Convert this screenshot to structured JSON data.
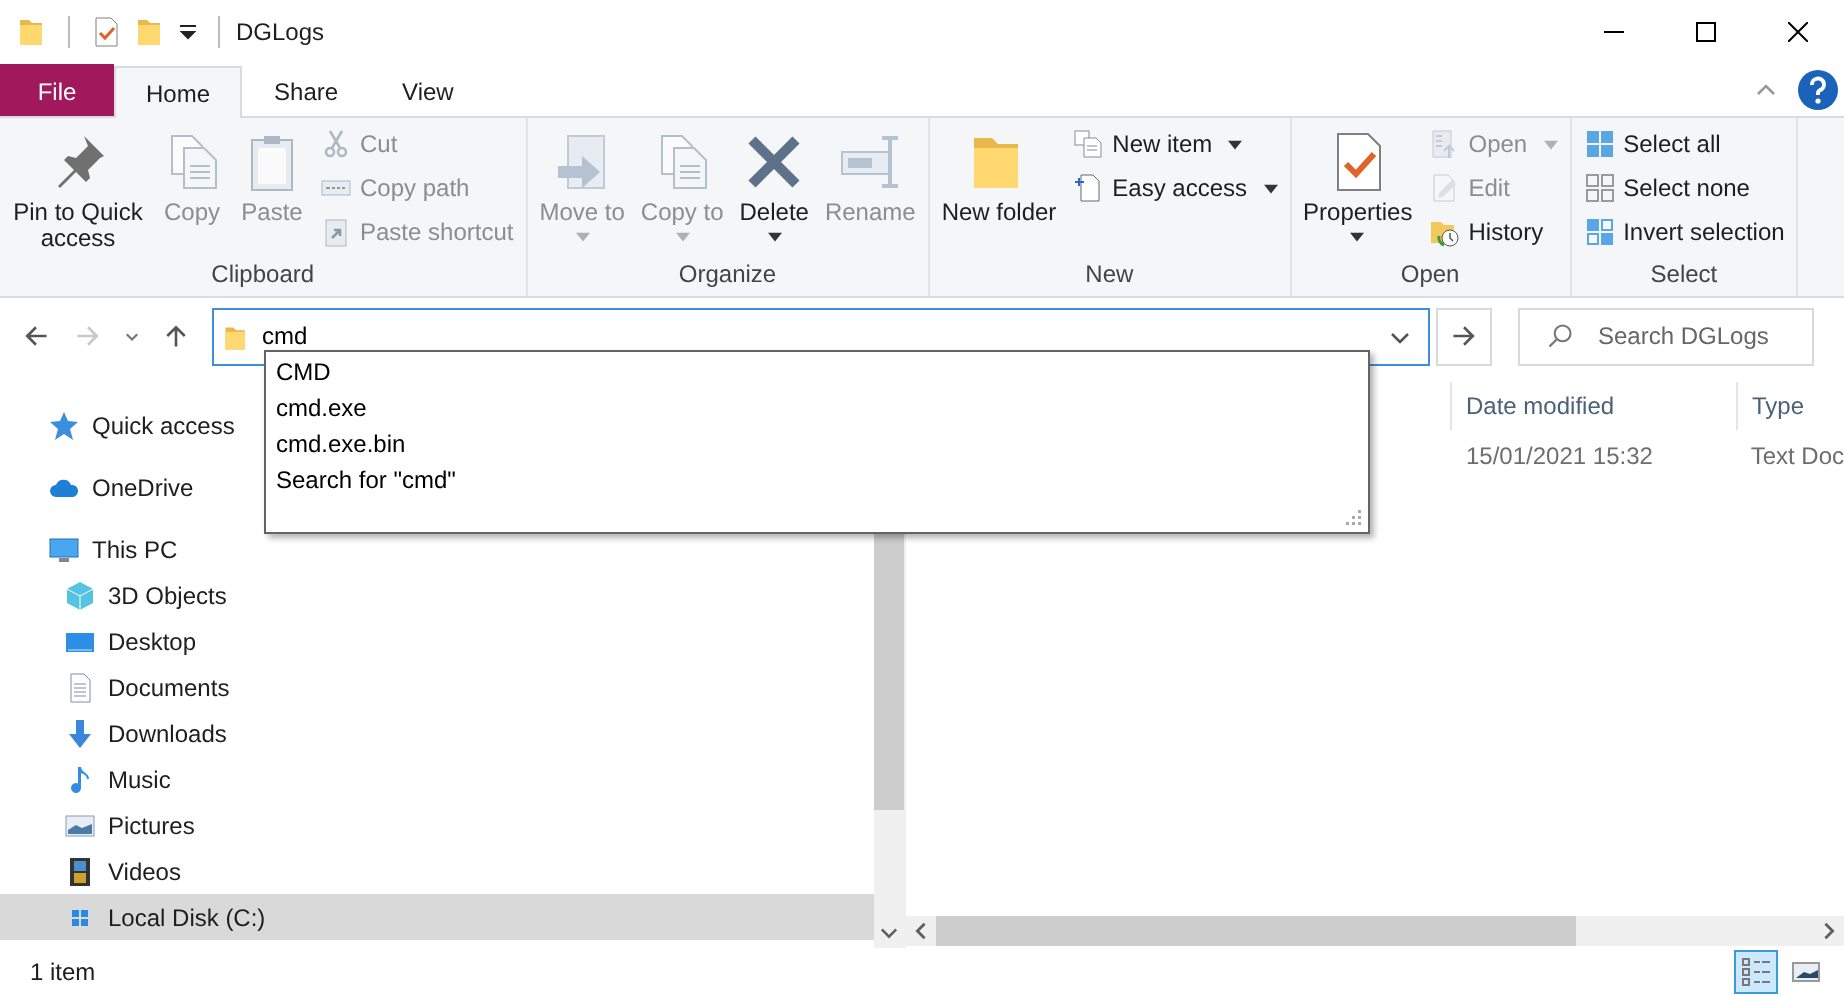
{
  "window": {
    "title": "DGLogs"
  },
  "tabs": [
    {
      "label": "File",
      "kind": "file",
      "selected": false
    },
    {
      "label": "Home",
      "kind": "tab",
      "selected": true
    },
    {
      "label": "Share",
      "kind": "tab",
      "selected": false
    },
    {
      "label": "View",
      "kind": "tab",
      "selected": false
    }
  ],
  "ribbon": {
    "groups": [
      {
        "label": "Clipboard",
        "items": [
          {
            "kind": "large",
            "label": "Pin to Quick access",
            "disabled": false,
            "has_menu": false
          },
          {
            "kind": "large",
            "label": "Copy",
            "disabled": true,
            "has_menu": false
          },
          {
            "kind": "large",
            "label": "Paste",
            "disabled": true,
            "has_menu": false
          },
          {
            "kind": "small",
            "label": "Cut",
            "disabled": true,
            "has_menu": false
          },
          {
            "kind": "small",
            "label": "Copy path",
            "disabled": true,
            "has_menu": false
          },
          {
            "kind": "small",
            "label": "Paste shortcut",
            "disabled": true,
            "has_menu": false
          }
        ]
      },
      {
        "label": "Organize",
        "items": [
          {
            "kind": "large",
            "label": "Move to",
            "disabled": true,
            "has_menu": true
          },
          {
            "kind": "large",
            "label": "Copy to",
            "disabled": true,
            "has_menu": true
          },
          {
            "kind": "large",
            "label": "Delete",
            "disabled": false,
            "has_menu": true
          },
          {
            "kind": "large",
            "label": "Rename",
            "disabled": true,
            "has_menu": false
          }
        ]
      },
      {
        "label": "New",
        "items": [
          {
            "kind": "large",
            "label": "New folder",
            "disabled": false,
            "has_menu": false
          },
          {
            "kind": "small",
            "label": "New item",
            "disabled": false,
            "has_menu": true
          },
          {
            "kind": "small",
            "label": "Easy access",
            "disabled": false,
            "has_menu": true
          }
        ]
      },
      {
        "label": "Open",
        "items": [
          {
            "kind": "large",
            "label": "Properties",
            "disabled": false,
            "has_menu": true
          },
          {
            "kind": "small",
            "label": "Open",
            "disabled": true,
            "has_menu": true
          },
          {
            "kind": "small",
            "label": "Edit",
            "disabled": true,
            "has_menu": false
          },
          {
            "kind": "small",
            "label": "History",
            "disabled": false,
            "has_menu": false
          }
        ]
      },
      {
        "label": "Select",
        "items": [
          {
            "kind": "small",
            "label": "Select all",
            "disabled": false,
            "has_menu": false
          },
          {
            "kind": "small",
            "label": "Select none",
            "disabled": false,
            "has_menu": false
          },
          {
            "kind": "small",
            "label": "Invert selection",
            "disabled": false,
            "has_menu": false
          }
        ]
      }
    ]
  },
  "nav_buttons": [
    {
      "kind": "back",
      "disabled": false
    },
    {
      "kind": "forward",
      "disabled": true
    },
    {
      "kind": "recent",
      "disabled": false
    },
    {
      "kind": "up",
      "disabled": false
    }
  ],
  "address": {
    "value": "cmd"
  },
  "suggestions": [
    "CMD",
    "cmd.exe",
    "cmd.exe.bin",
    "Search for \"cmd\""
  ],
  "search": {
    "placeholder": "Search DGLogs"
  },
  "navigation": [
    {
      "label": "Quick access",
      "selected": false
    },
    {
      "label": "OneDrive",
      "selected": false
    },
    {
      "label": "This PC",
      "selected": false,
      "children": [
        {
          "label": "3D Objects",
          "selected": false
        },
        {
          "label": "Desktop",
          "selected": false
        },
        {
          "label": "Documents",
          "selected": false
        },
        {
          "label": "Downloads",
          "selected": false
        },
        {
          "label": "Music",
          "selected": false
        },
        {
          "label": "Pictures",
          "selected": false
        },
        {
          "label": "Videos",
          "selected": false
        },
        {
          "label": "Local Disk (C:)",
          "selected": true
        }
      ]
    }
  ],
  "file_list": {
    "columns": [
      "Date modified",
      "Type"
    ],
    "rows": [
      {
        "cells": [
          "15/01/2021 15:32",
          "Text Doc"
        ]
      }
    ]
  },
  "status_bar": {
    "text": "1 item",
    "views": [
      {
        "selected": true
      },
      {
        "selected": false
      }
    ]
  }
}
